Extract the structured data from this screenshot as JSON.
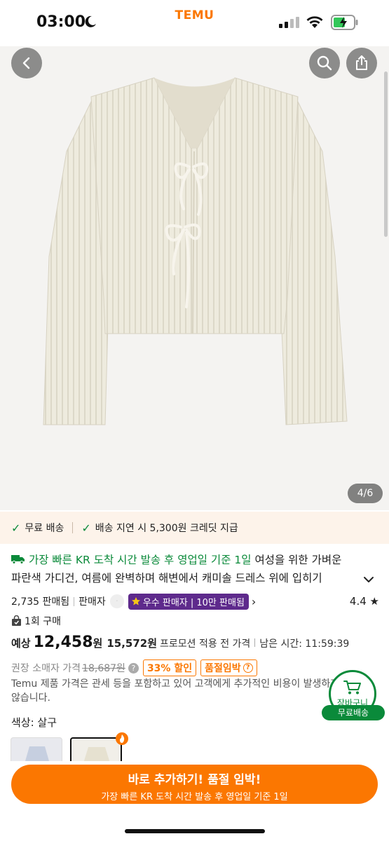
{
  "status_bar": {
    "time": "03:00",
    "brand": "TEMU"
  },
  "gallery": {
    "counter": "4/6"
  },
  "benefits": {
    "free_shipping": "무료 배송",
    "delay_credit": "배송 지연 시 5,300원 크레딧 지급"
  },
  "product": {
    "shipping_line": "가장 빠른 KR 도착 시간 발송 후 영업일 기준 1일",
    "title_line1": "여성을 위한 가벼운",
    "title_line2": "파란색 가디건, 여름에 완벽하며 해변에서 캐미솔 드레스 위에 입히기",
    "sold": "2,735 판매됨",
    "seller": "판매자",
    "seller_badge": "우수 판매자 | 10만 판매됨",
    "rating": "4.4",
    "purchase_count": "1회 구매"
  },
  "price": {
    "label": "예상",
    "value": "12,458",
    "currency": "원",
    "pre_promo": "15,572원",
    "pre_promo_note": "프로모션 적용 전 가격",
    "time_left": "남은 시간: 11:59:39",
    "rrp_label": "권장 소매자 가격",
    "rrp_value": "18,687원",
    "discount": "33% 할인",
    "stock": "품절임박",
    "disclaimer": "Temu 제품 가격은 관세 등을 포함하고 있어 고객에게 추가적인 비용이 발생하지 않습니다."
  },
  "color": {
    "label": "색상: 살구"
  },
  "cart": {
    "label": "장바구니",
    "free_shipping": "무료배송"
  },
  "cta": {
    "main": "바로 추가하기! 품절 임박!",
    "sub": "가장 빠른 KR 도착 시간 발송 후 영업일 기준 1일"
  },
  "colors": {
    "accent": "#fb7701",
    "green": "#0a8a3a",
    "badge_purple": "#5e2a8c"
  }
}
